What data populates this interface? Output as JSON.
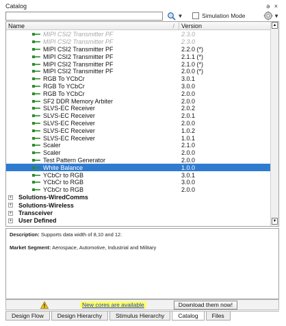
{
  "window": {
    "title": "Catalog",
    "controls_glyph": "ə ×"
  },
  "search": {
    "value": "",
    "simulation_mode_label": "Simulation Mode"
  },
  "tree": {
    "col_name": "Name",
    "col_version": "Version",
    "rows": [
      {
        "name": "MIPI CSI2 Transmitter PF",
        "version": "2.3.0",
        "style": "faded"
      },
      {
        "name": "MIPI CSI2 Transmitter PF",
        "version": "2.3.0",
        "style": "faded"
      },
      {
        "name": "MIPI CSI2 Transmitter PF",
        "version": "2.2.0 (*)",
        "style": ""
      },
      {
        "name": "MIPI CSI2 Transmitter PF",
        "version": "2.1.1 (*)",
        "style": ""
      },
      {
        "name": "MIPI CSI2 Transmitter PF",
        "version": "2.1.0 (*)",
        "style": ""
      },
      {
        "name": "MIPI CSI2 Transmitter PF",
        "version": "2.0.0 (*)",
        "style": ""
      },
      {
        "name": "RGB To YCbCr",
        "version": "3.0.1",
        "style": ""
      },
      {
        "name": "RGB To YCbCr",
        "version": "3.0.0",
        "style": ""
      },
      {
        "name": "RGB To YCbCr",
        "version": "2.0.0",
        "style": ""
      },
      {
        "name": "SF2 DDR Memory Arbiter",
        "version": "2.0.0",
        "style": ""
      },
      {
        "name": "SLVS-EC Receiver",
        "version": "2.0.2",
        "style": ""
      },
      {
        "name": "SLVS-EC Receiver",
        "version": "2.0.1",
        "style": ""
      },
      {
        "name": "SLVS-EC Receiver",
        "version": "2.0.0",
        "style": ""
      },
      {
        "name": "SLVS-EC Receiver",
        "version": "1.0.2",
        "style": ""
      },
      {
        "name": "SLVS-EC Receiver",
        "version": "1.0.1",
        "style": ""
      },
      {
        "name": "Scaler",
        "version": "2.1.0",
        "style": ""
      },
      {
        "name": "Scaler",
        "version": "2.0.0",
        "style": ""
      },
      {
        "name": "Test Pattern Generator",
        "version": "2.0.0",
        "style": ""
      },
      {
        "name": "White Balance",
        "version": "1.0.0",
        "style": "sel"
      },
      {
        "name": "YCbCr to RGB",
        "version": "3.0.1",
        "style": ""
      },
      {
        "name": "YCbCr to RGB",
        "version": "3.0.0",
        "style": ""
      },
      {
        "name": "YCbCr to RGB",
        "version": "2.0.0",
        "style": ""
      }
    ],
    "groups": [
      {
        "name": "Solutions-WiredComms"
      },
      {
        "name": "Solutions-Wireless"
      },
      {
        "name": "Transceiver"
      },
      {
        "name": "User Defined"
      }
    ]
  },
  "description": {
    "desc_label": "Description:",
    "desc_text": " Supports data width of 8,10 and 12.",
    "market_label": "Market Segment:",
    "market_text": " Aerospace, Automotive, Industrial and Military"
  },
  "notice": {
    "link_text": "New cores are available",
    "button_label": "Download them now!"
  },
  "tabs": [
    {
      "label": "Design Flow",
      "active": false
    },
    {
      "label": "Design Hierarchy",
      "active": false
    },
    {
      "label": "Stimulus Hierarchy",
      "active": false
    },
    {
      "label": "Catalog",
      "active": true
    },
    {
      "label": "Files",
      "active": false
    }
  ],
  "colors": {
    "selection": "#2f7bd0",
    "ip_icon": "#2e8b2e",
    "link": "#1a3cc0",
    "link_highlight": "#ffff66"
  }
}
